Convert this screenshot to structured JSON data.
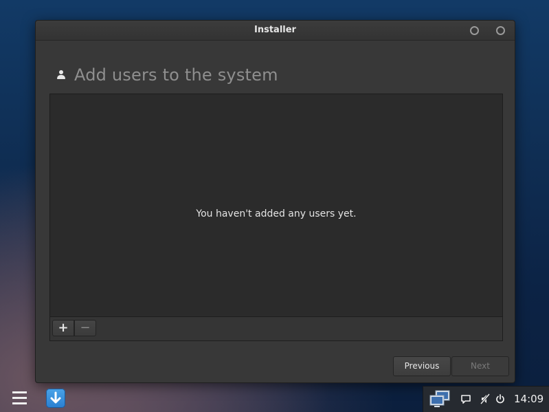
{
  "window": {
    "title": "Installer"
  },
  "page": {
    "heading": "Add users to the system",
    "empty_message": "You haven't added any users yet."
  },
  "list_toolbar": {
    "add_label": "+",
    "remove_label": "−"
  },
  "navigation": {
    "previous_label": "Previous",
    "next_label": "Next"
  },
  "taskbar": {
    "clock": "14:09"
  },
  "icons": {
    "heading": "user-icon",
    "menu": "menu-icon",
    "launcher": "download-arrow-icon",
    "tray": [
      "network-icon",
      "chat-icon",
      "volume-muted-icon",
      "power-icon"
    ]
  },
  "colors": {
    "window_bg": "#383838",
    "list_bg": "#2b2b2b",
    "launcher_accent": "#2a7fd0"
  }
}
